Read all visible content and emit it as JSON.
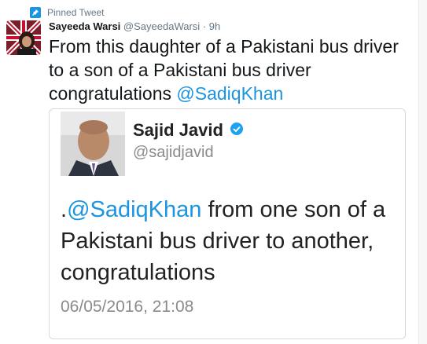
{
  "pinned": {
    "label": "Pinned Tweet",
    "icon": "pin-icon"
  },
  "tweet": {
    "author_name": "Sayeeda Warsi",
    "author_handle": "@SayeedaWarsi",
    "separator": "·",
    "time": "9h",
    "text_before": "From this daughter of a Pakistani bus driver to a son of a Pakistani bus driver congratulations ",
    "mention": "@SadiqKhan"
  },
  "quoted": {
    "name": "Sajid Javid",
    "handle": "@sajidjavid",
    "verified_icon": "verified-badge-icon",
    "text_prefix": ".",
    "mention": "@SadiqKhan",
    "text_after": " from one son of a Pakistani bus driver to another, congratulations",
    "date": "06/05/2016, 21:08"
  },
  "colors": {
    "accent": "#1b95e0",
    "muted": "#657786",
    "text": "#14171a"
  }
}
